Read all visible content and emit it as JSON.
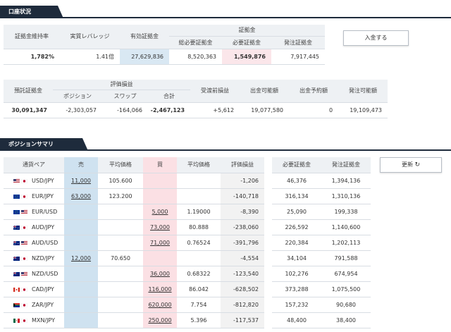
{
  "account": {
    "title": "口座状況",
    "h_maintenance_rate": "証拠金維持率",
    "h_leverage": "実質レバレッジ",
    "h_valid_margin": "有効証拠金",
    "h_margin_group": "証拠金",
    "h_total_required": "総必要証拠金",
    "h_required": "必要証拠金",
    "h_order_margin": "発注証拠金",
    "maintenance_rate": "1,782%",
    "leverage": "1.41倍",
    "valid_margin": "27,629,836",
    "total_required": "8,520,363",
    "required": "1,549,876",
    "order_margin": "7,917,445",
    "deposit_button": "入金する",
    "h_deposit": "預託証拠金",
    "h_pl_group": "評価損益",
    "h_position": "ポジション",
    "h_swap": "スワップ",
    "h_total": "合計",
    "h_pre_settle": "受渡前損益",
    "h_withdrawable": "出金可能額",
    "h_withdraw_reserved": "出金予約額",
    "h_orderable": "発注可能額",
    "deposit": "30,091,347",
    "position_pl": "-2,303,057",
    "swap": "-164,066",
    "total_pl": "-2,467,123",
    "pre_settle": "+5,612",
    "withdrawable": "19,077,580",
    "withdraw_reserved": "0",
    "orderable": "19,109,473"
  },
  "summary": {
    "title": "ポジションサマリ",
    "refresh_button": "更新",
    "h_pair": "通貨ペア",
    "h_sell": "売",
    "h_avg_sell": "平均価格",
    "h_buy": "買",
    "h_avg_buy": "平均価格",
    "h_pl": "評価損益",
    "h_required": "必要証拠金",
    "h_order": "発注証拠金",
    "rows": [
      {
        "pair": "USD/JPY",
        "f1": "us",
        "f2": "jp",
        "sell": "11,000",
        "avg_sell": "105.600",
        "buy": "",
        "avg_buy": "",
        "pl": "-1,206",
        "req": "46,376",
        "order": "1,394,136"
      },
      {
        "pair": "EUR/JPY",
        "f1": "eu",
        "f2": "jp",
        "sell": "63,000",
        "avg_sell": "123.200",
        "buy": "",
        "avg_buy": "",
        "pl": "-140,718",
        "req": "316,134",
        "order": "1,310,136"
      },
      {
        "pair": "EUR/USD",
        "f1": "eu",
        "f2": "us",
        "sell": "",
        "avg_sell": "",
        "buy": "5,000",
        "avg_buy": "1.19000",
        "pl": "-8,390",
        "req": "25,090",
        "order": "199,338"
      },
      {
        "pair": "AUD/JPY",
        "f1": "au",
        "f2": "jp",
        "sell": "",
        "avg_sell": "",
        "buy": "73,000",
        "avg_buy": "80.888",
        "pl": "-238,060",
        "req": "226,592",
        "order": "1,140,600"
      },
      {
        "pair": "AUD/USD",
        "f1": "au",
        "f2": "us",
        "sell": "",
        "avg_sell": "",
        "buy": "71,000",
        "avg_buy": "0.76524",
        "pl": "-391,796",
        "req": "220,384",
        "order": "1,202,113"
      },
      {
        "pair": "NZD/JPY",
        "f1": "nz",
        "f2": "jp",
        "sell": "12,000",
        "avg_sell": "70.650",
        "buy": "",
        "avg_buy": "",
        "pl": "-4,554",
        "req": "34,104",
        "order": "791,588"
      },
      {
        "pair": "NZD/USD",
        "f1": "nz",
        "f2": "us",
        "sell": "",
        "avg_sell": "",
        "buy": "36,000",
        "avg_buy": "0.68322",
        "pl": "-123,540",
        "req": "102,276",
        "order": "674,954"
      },
      {
        "pair": "CAD/JPY",
        "f1": "ca",
        "f2": "jp",
        "sell": "",
        "avg_sell": "",
        "buy": "116,000",
        "avg_buy": "86.042",
        "pl": "-628,502",
        "req": "373,288",
        "order": "1,075,500"
      },
      {
        "pair": "ZAR/JPY",
        "f1": "za",
        "f2": "jp",
        "sell": "",
        "avg_sell": "",
        "buy": "620,000",
        "avg_buy": "7.754",
        "pl": "-812,820",
        "req": "157,232",
        "order": "90,680"
      },
      {
        "pair": "MXN/JPY",
        "f1": "mx",
        "f2": "jp",
        "sell": "",
        "avg_sell": "",
        "buy": "250,000",
        "avg_buy": "5.396",
        "pl": "-117,537",
        "req": "48,400",
        "order": "38,400"
      }
    ]
  }
}
